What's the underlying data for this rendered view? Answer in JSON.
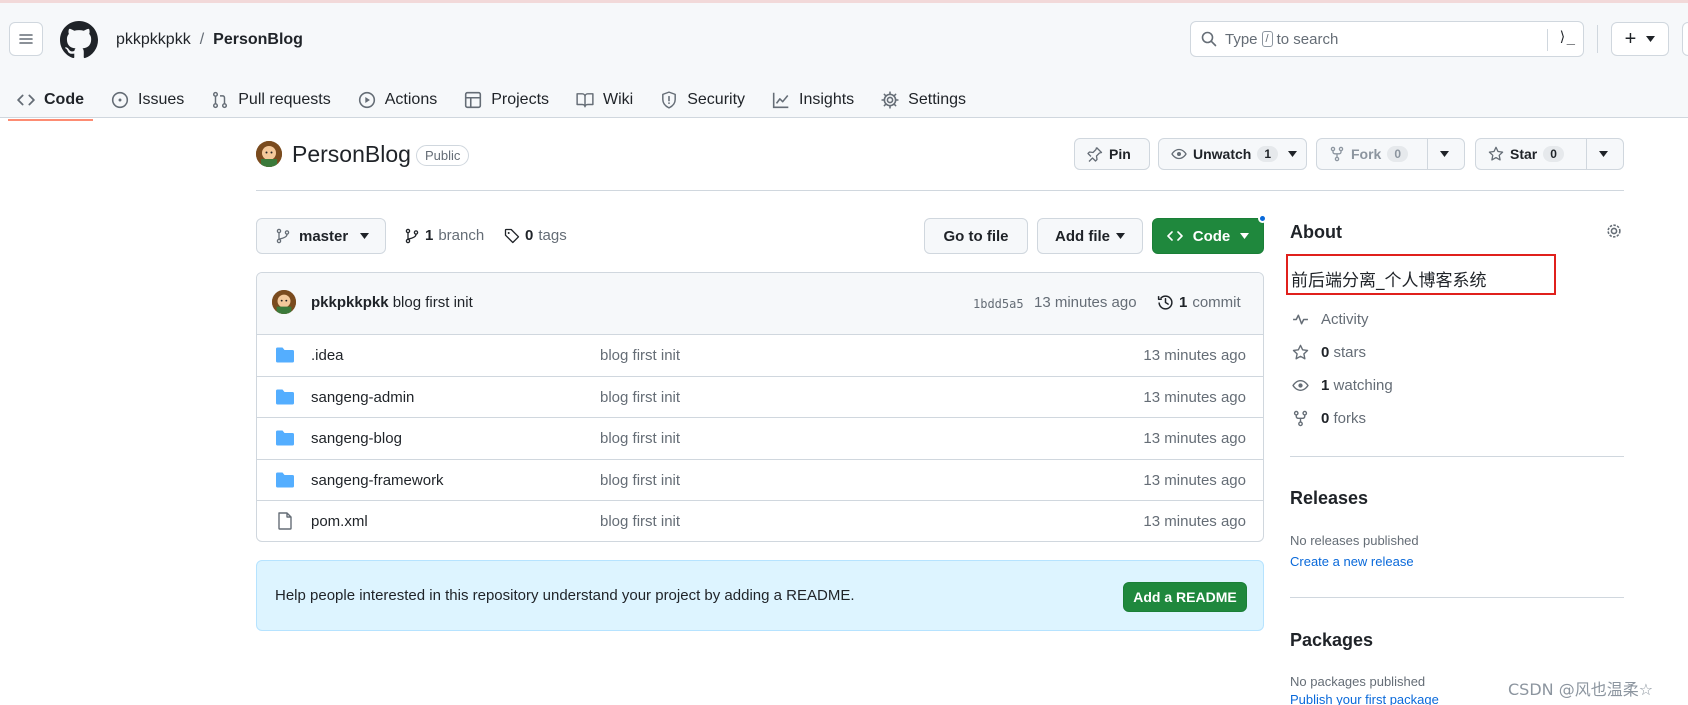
{
  "header": {
    "owner": "pkkpkkpkk",
    "separator": "/",
    "repo": "PersonBlog",
    "search_before": "Type",
    "search_key": "/",
    "search_after": "to search",
    "command_glyph": "⟩_"
  },
  "tabs": [
    {
      "label": "Code",
      "icon": "code-icon",
      "selected": true
    },
    {
      "label": "Issues",
      "icon": "issue-icon"
    },
    {
      "label": "Pull requests",
      "icon": "pull-request-icon"
    },
    {
      "label": "Actions",
      "icon": "play-icon"
    },
    {
      "label": "Projects",
      "icon": "table-icon"
    },
    {
      "label": "Wiki",
      "icon": "book-icon"
    },
    {
      "label": "Security",
      "icon": "shield-icon"
    },
    {
      "label": "Insights",
      "icon": "graph-icon"
    },
    {
      "label": "Settings",
      "icon": "gear-icon"
    }
  ],
  "repo": {
    "title": "PersonBlog",
    "visibility": "Public",
    "pin": "Pin",
    "unwatch": "Unwatch",
    "watch_count": "1",
    "fork": "Fork",
    "fork_count": "0",
    "star": "Star",
    "star_count": "0"
  },
  "branch": {
    "name": "master",
    "branch_count": "1",
    "branch_label": "branch",
    "tag_count": "0",
    "tag_label": "tags",
    "go_to_file": "Go to file",
    "add_file": "Add file",
    "code": "Code"
  },
  "commit": {
    "author": "pkkpkkpkk",
    "message": "blog first init",
    "sha": "1bdd5a5",
    "time": "13 minutes ago",
    "count": "1",
    "count_label": "commit"
  },
  "files": [
    {
      "name": ".idea",
      "type": "folder",
      "message": "blog first init",
      "time": "13 minutes ago"
    },
    {
      "name": "sangeng-admin",
      "type": "folder",
      "message": "blog first init",
      "time": "13 minutes ago"
    },
    {
      "name": "sangeng-blog",
      "type": "folder",
      "message": "blog first init",
      "time": "13 minutes ago"
    },
    {
      "name": "sangeng-framework",
      "type": "folder",
      "message": "blog first init",
      "time": "13 minutes ago"
    },
    {
      "name": "pom.xml",
      "type": "file",
      "message": "blog first init",
      "time": "13 minutes ago"
    }
  ],
  "readme": {
    "text": "Help people interested in this repository understand your project by adding a README.",
    "button": "Add a README"
  },
  "about": {
    "heading": "About",
    "description": "前后端分离_个人博客系统",
    "activity": "Activity",
    "stars_count": "0",
    "stars_label": "stars",
    "watching_count": "1",
    "watching_label": "watching",
    "forks_count": "0",
    "forks_label": "forks"
  },
  "releases": {
    "heading": "Releases",
    "none": "No releases published",
    "create": "Create a new release"
  },
  "packages": {
    "heading": "Packages",
    "none": "No packages published",
    "publish": "Publish your first package"
  },
  "watermark": "CSDN @风也温柔☆",
  "colors": {
    "accent_green": "#1f883d",
    "link_blue": "#0969da",
    "folder_blue": "#54aeff",
    "tab_underline": "#fd8c73",
    "highlight_red": "#e0201c"
  }
}
